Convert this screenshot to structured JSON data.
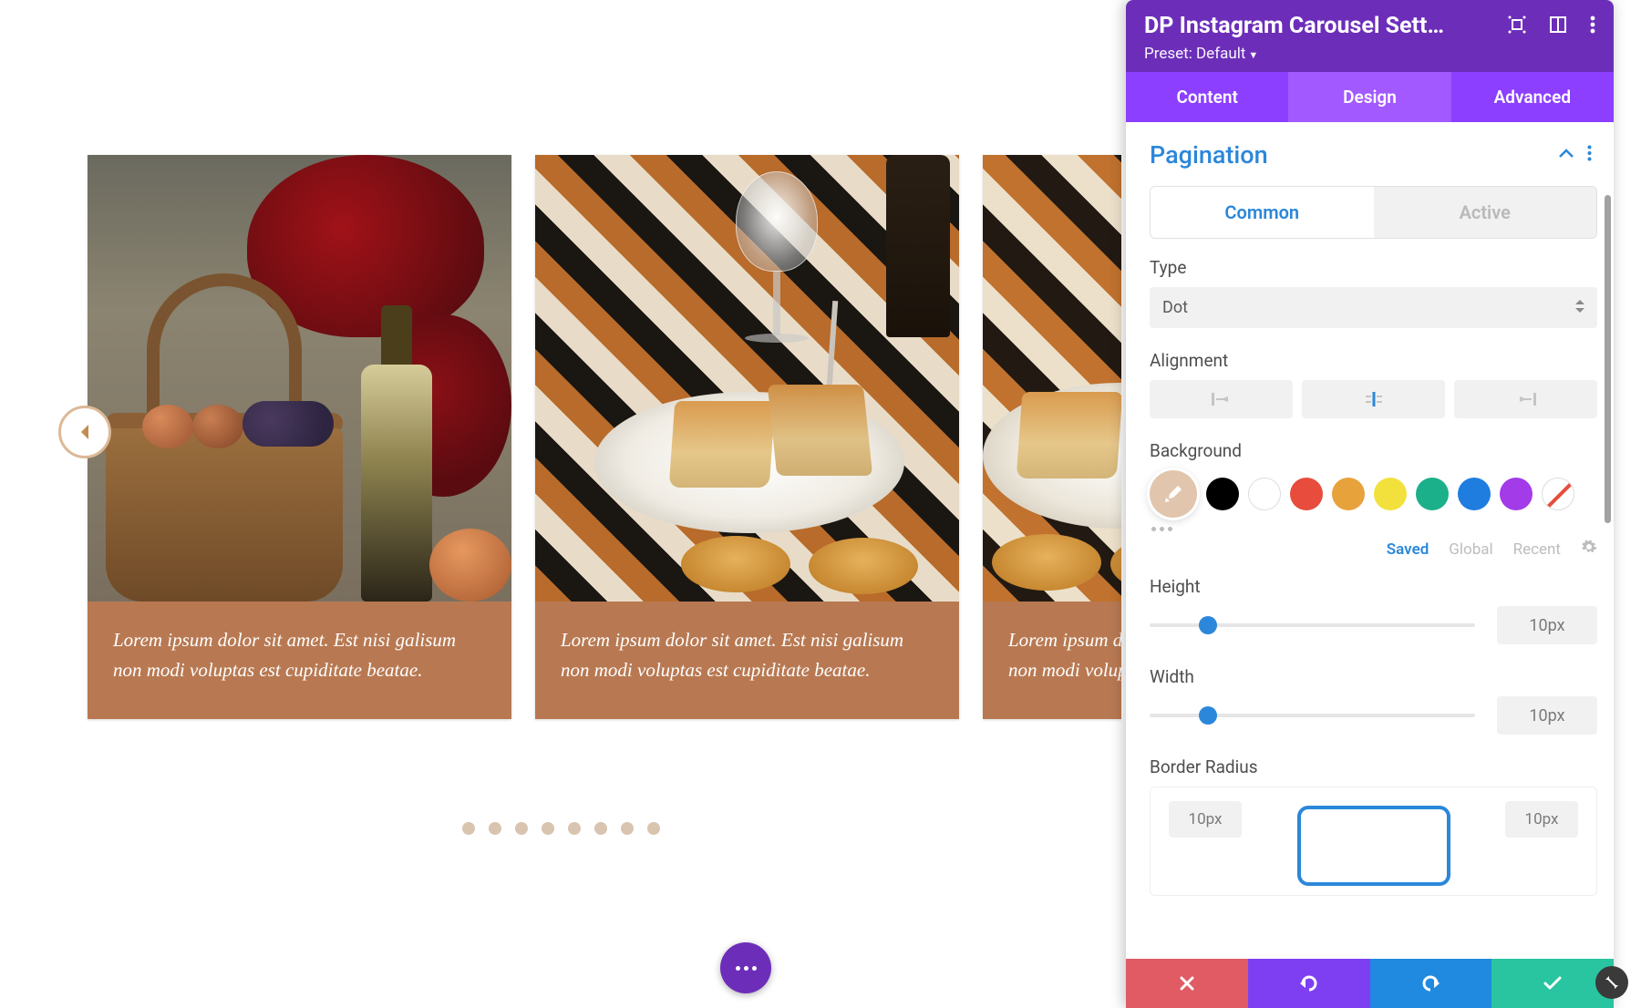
{
  "carousel": {
    "caption": "Lorem ipsum dolor sit amet. Est nisi galisum non modi voluptas est cupiditate beatae.",
    "dot_count": 8
  },
  "panel": {
    "title": "DP Instagram Carousel Sett...",
    "preset_label": "Preset: Default",
    "tabs": {
      "content": "Content",
      "design": "Design",
      "advanced": "Advanced"
    },
    "section": {
      "title": "Pagination"
    },
    "subtabs": {
      "common": "Common",
      "active": "Active"
    },
    "type": {
      "label": "Type",
      "value": "Dot"
    },
    "alignment": {
      "label": "Alignment"
    },
    "background": {
      "label": "Background",
      "swatches": [
        "#000000",
        "#ffffff",
        "#e74c3c",
        "#e8a23b",
        "#f2e13c",
        "#1bb08a",
        "#1f7ddf",
        "#a33be8"
      ],
      "picker": "#e1c6ad",
      "tabs": {
        "saved": "Saved",
        "global": "Global",
        "recent": "Recent"
      }
    },
    "height": {
      "label": "Height",
      "value": "10px"
    },
    "width": {
      "label": "Width",
      "value": "10px"
    },
    "border_radius": {
      "label": "Border Radius",
      "tl": "10px",
      "tr": "10px"
    }
  },
  "footer": {
    "cancel": "cancel",
    "undo": "undo",
    "redo": "redo",
    "save": "save"
  }
}
